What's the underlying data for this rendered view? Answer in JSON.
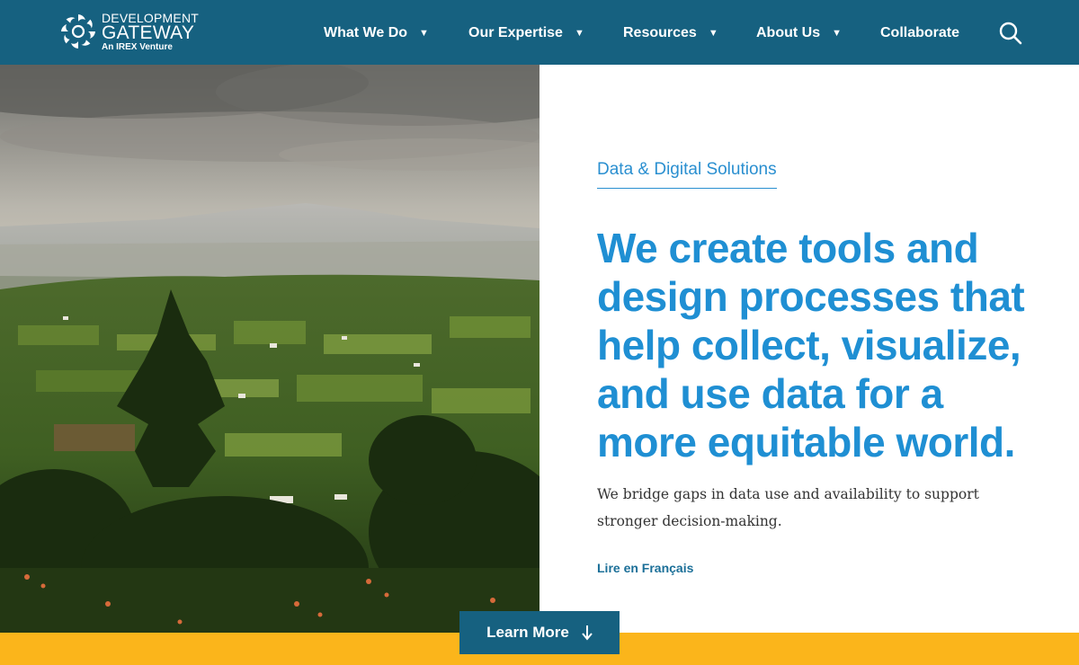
{
  "brand": {
    "line1": "DEVELOPMENT",
    "line2": "GATEWAY",
    "line3": "An IREX Venture",
    "logo_icon": "swirl-logo-icon"
  },
  "nav": {
    "items": [
      {
        "label": "What We Do",
        "has_dropdown": true
      },
      {
        "label": "Our Expertise",
        "has_dropdown": true
      },
      {
        "label": "Resources",
        "has_dropdown": true
      },
      {
        "label": "About Us",
        "has_dropdown": true
      },
      {
        "label": "Collaborate",
        "has_dropdown": false
      }
    ],
    "dropdown_glyph": "▼",
    "search_icon": "search-icon"
  },
  "hero": {
    "image_subject": "landscape-photo",
    "eyebrow": "Data & Digital Solutions",
    "headline": "We create tools and design processes that help collect, visualize, and use data for a more equitable world.",
    "subtext": "We bridge gaps in data use and availability to support stronger decision-making.",
    "lang_link": "Lire en Français"
  },
  "cta": {
    "label": "Learn More",
    "icon": "arrow-down-icon"
  },
  "colors": {
    "header_bg": "#166180",
    "accent_blue": "#1f8fd3",
    "yellow": "#fbb51b",
    "link": "#1b6f98"
  }
}
